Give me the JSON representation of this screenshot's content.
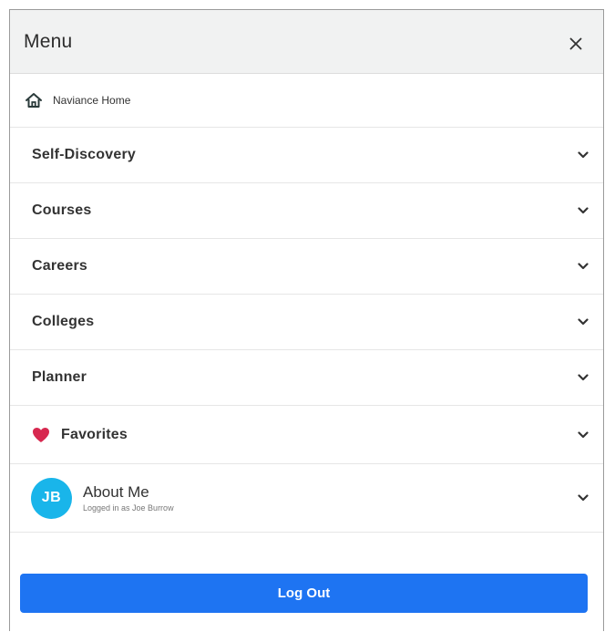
{
  "header": {
    "title": "Menu",
    "close_icon": "close-icon"
  },
  "home": {
    "label": "Naviance Home",
    "icon": "home-icon"
  },
  "menu": {
    "items": [
      {
        "label": "Self-Discovery",
        "icon": "chevron-down-icon"
      },
      {
        "label": "Courses",
        "icon": "chevron-down-icon"
      },
      {
        "label": "Careers",
        "icon": "chevron-down-icon"
      },
      {
        "label": "Colleges",
        "icon": "chevron-down-icon"
      },
      {
        "label": "Planner",
        "icon": "chevron-down-icon"
      }
    ],
    "favorites": {
      "label": "Favorites",
      "icon": "heart-icon",
      "icon_color": "#d7284f"
    }
  },
  "about": {
    "initials": "JB",
    "title": "About Me",
    "subtitle": "Logged in as Joe Burrow",
    "avatar_color": "#19b5ea"
  },
  "logout": {
    "label": "Log Out",
    "color": "#1e74f2"
  }
}
